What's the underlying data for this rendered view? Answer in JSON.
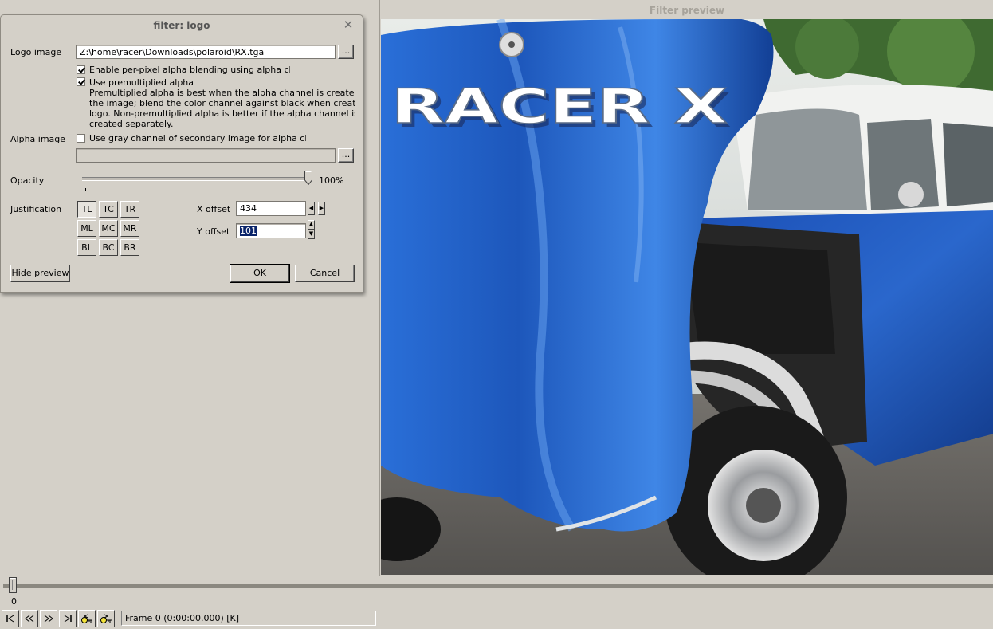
{
  "preview": {
    "title": "Filter preview",
    "logo_text": "RACER X"
  },
  "dialog": {
    "title": "filter: logo",
    "logo_image_label": "Logo image",
    "logo_image_path": "Z:\\home\\racer\\Downloads\\polaroid\\RX.tga",
    "browse_label": "...",
    "enable_alpha_label": "Enable per-pixel alpha blending using alpha cha",
    "enable_alpha_checked": true,
    "premultiplied_label": "Use premultiplied alpha",
    "premultiplied_checked": true,
    "premultiplied_desc": [
      "Premultiplied alpha is best when the alpha channel is created w",
      "the image; blend the color channel against black when creatin",
      "logo.  Non-premultiplied alpha is better if the alpha channel is",
      "created separately."
    ],
    "alpha_image_label": "Alpha image",
    "gray_channel_label": "Use gray channel of secondary image for alpha cha",
    "gray_channel_checked": false,
    "alpha_image_path": "",
    "opacity_label": "Opacity",
    "opacity_value": "100%",
    "opacity_fraction": 1.0,
    "justification_label": "Justification",
    "justification": [
      [
        "TL",
        "TC",
        "TR"
      ],
      [
        "ML",
        "MC",
        "MR"
      ],
      [
        "BL",
        "BC",
        "BR"
      ]
    ],
    "justification_selected": "TL",
    "x_offset_label": "X offset",
    "x_offset_value": "434",
    "y_offset_label": "Y offset",
    "y_offset_value": "101",
    "hide_preview_label": "Hide preview",
    "ok_label": "OK",
    "cancel_label": "Cancel"
  },
  "timeline": {
    "position_label": "0",
    "status": "Frame 0 (0:00:00.000) [K]",
    "buttons": [
      "go-start-icon",
      "step-back-icon",
      "step-forward-icon",
      "go-end-icon",
      "key-prev-icon",
      "key-next-icon"
    ]
  },
  "colors": {
    "car_blue": "#1f5fc4",
    "dialog_bg": "#d4d0c8",
    "selection": "#0a246a"
  }
}
